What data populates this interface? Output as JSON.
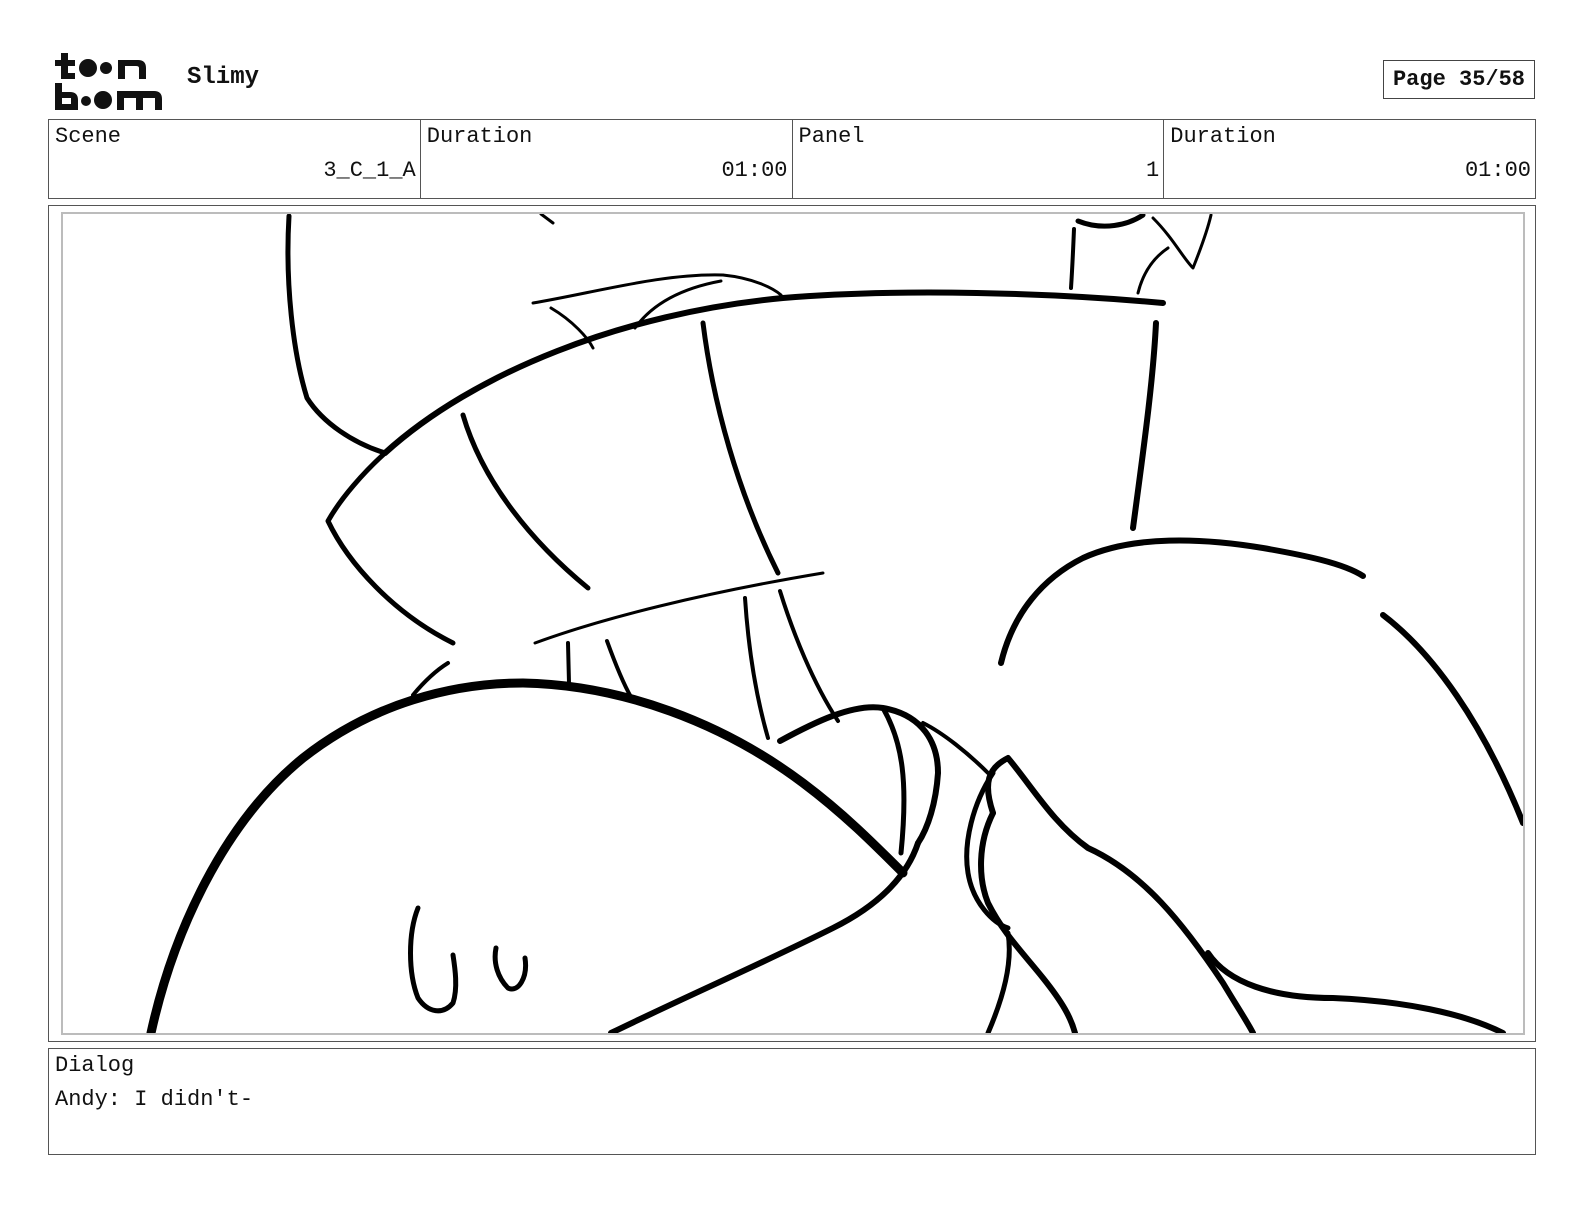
{
  "header": {
    "logo_text": "toon boom",
    "project_title": "Slimy",
    "page_label": "Page 35/58"
  },
  "info": {
    "scene_label": "Scene",
    "scene_value": "3_C_1_A",
    "duration_label": "Duration",
    "duration_value": "01:00",
    "panel_label": "Panel",
    "panel_value": "1",
    "panel_duration_label": "Duration",
    "panel_duration_value": "01:00"
  },
  "panel": {
    "sketch_icon": "storyboard-sketch"
  },
  "dialog": {
    "label": "Dialog",
    "text": "Andy: I didn't-"
  }
}
